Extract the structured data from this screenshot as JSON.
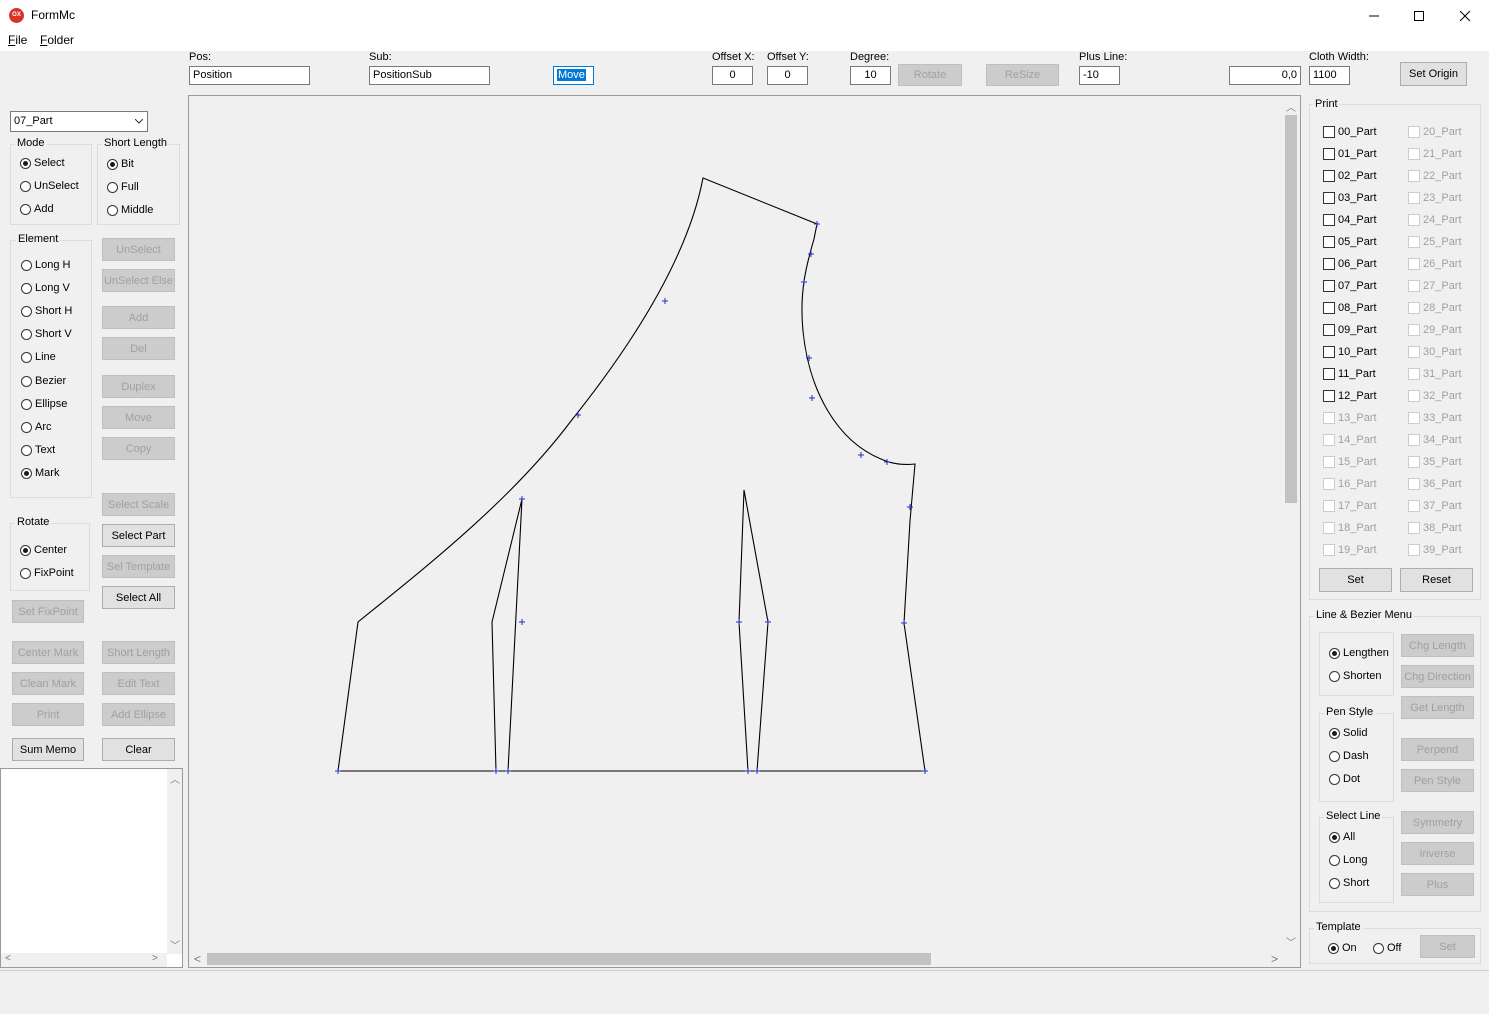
{
  "window": {
    "title": "FormMc",
    "icon": "app-ox-icon"
  },
  "menu": [
    {
      "label": "File",
      "mnemonic": "F",
      "rest": "ile"
    },
    {
      "label": "Folder",
      "mnemonic": "F",
      "rest": "older"
    }
  ],
  "toolbar": {
    "pos_label": "Pos:",
    "pos_value": "Position",
    "sub_label": "Sub:",
    "sub_value": "PositionSub",
    "move_value": "Move",
    "offset_x_label": "Offset X:",
    "offset_x_value": "0",
    "offset_y_label": "Offset Y:",
    "offset_y_value": "0",
    "degree_label": "Degree:",
    "degree_value": "10",
    "rotate_label": "Rotate",
    "resize_label": "ReSize",
    "plus_line_label": "Plus Line:",
    "plus_line_value": "-10",
    "coord_value": "0,0",
    "cloth_width_label": "Cloth Width:",
    "cloth_width_value": "1100",
    "set_origin_label": "Set Origin"
  },
  "left": {
    "part_select": "07_Part",
    "mode": {
      "title": "Mode",
      "options": [
        "Select",
        "UnSelect",
        "Add"
      ],
      "selected": "Select"
    },
    "short_length": {
      "title": "Short Length",
      "options": [
        "Bit",
        "Full",
        "Middle"
      ],
      "selected": "Bit"
    },
    "element": {
      "title": "Element",
      "options": [
        "Long H",
        "Long V",
        "Short H",
        "Short V",
        "Line",
        "Bezier",
        "Ellipse",
        "Arc",
        "Text",
        "Mark"
      ],
      "selected": "Mark"
    },
    "rotate": {
      "title": "Rotate",
      "options": [
        "Center",
        "FixPoint"
      ],
      "selected": "Center"
    },
    "buttons": {
      "unselect": "UnSelect",
      "unselect_else": "UnSelect Else",
      "add": "Add",
      "del": "Del",
      "duplex": "Duplex",
      "move": "Move",
      "copy": "Copy",
      "select_scale": "Select Scale",
      "select_part": "Select Part",
      "sel_template": "Sel Template",
      "select_all": "Select All",
      "set_fixpoint": "Set FixPoint",
      "center_mark": "Center Mark",
      "short_length": "Short Length",
      "clean_mark": "Clean Mark",
      "edit_text": "Edit Text",
      "print": "Print",
      "add_ellipse": "Add Ellipse",
      "sum_memo": "Sum Memo",
      "clear": "Clear"
    }
  },
  "right": {
    "print": {
      "title": "Print",
      "parts_col1": [
        "00_Part",
        "01_Part",
        "02_Part",
        "03_Part",
        "04_Part",
        "05_Part",
        "06_Part",
        "07_Part",
        "08_Part",
        "09_Part",
        "10_Part",
        "11_Part",
        "12_Part",
        "13_Part",
        "14_Part",
        "15_Part",
        "16_Part",
        "17_Part",
        "18_Part",
        "19_Part"
      ],
      "parts_col2": [
        "20_Part",
        "21_Part",
        "22_Part",
        "23_Part",
        "24_Part",
        "25_Part",
        "26_Part",
        "27_Part",
        "28_Part",
        "29_Part",
        "30_Part",
        "31_Part",
        "32_Part",
        "33_Part",
        "34_Part",
        "35_Part",
        "36_Part",
        "37_Part",
        "38_Part",
        "39_Part"
      ],
      "enabled_count": 13,
      "set_label": "Set",
      "reset_label": "Reset"
    },
    "line_bezier": {
      "title": "Line & Bezier Menu",
      "length_options": [
        "Lengthen",
        "Shorten"
      ],
      "length_selected": "Lengthen",
      "pen_style": {
        "title": "Pen Style",
        "options": [
          "Solid",
          "Dash",
          "Dot"
        ],
        "selected": "Solid"
      },
      "select_line": {
        "title": "Select Line",
        "options": [
          "All",
          "Long",
          "Short"
        ],
        "selected": "All"
      },
      "buttons": {
        "chg_length": "Chg Length",
        "chg_direction": "Chg Direction",
        "get_length": "Get Length",
        "perpend": "Perpend",
        "pen_style": "Pen Style",
        "symmetry": "Symmetry",
        "inverse": "Inverse",
        "plus": "Plus"
      }
    },
    "template": {
      "title": "Template",
      "options": [
        "On",
        "Off"
      ],
      "selected": "On",
      "set_label": "Set"
    }
  },
  "colors": {
    "mark": "#2030c0",
    "outline": "#000000",
    "selection": "#0078d7"
  }
}
